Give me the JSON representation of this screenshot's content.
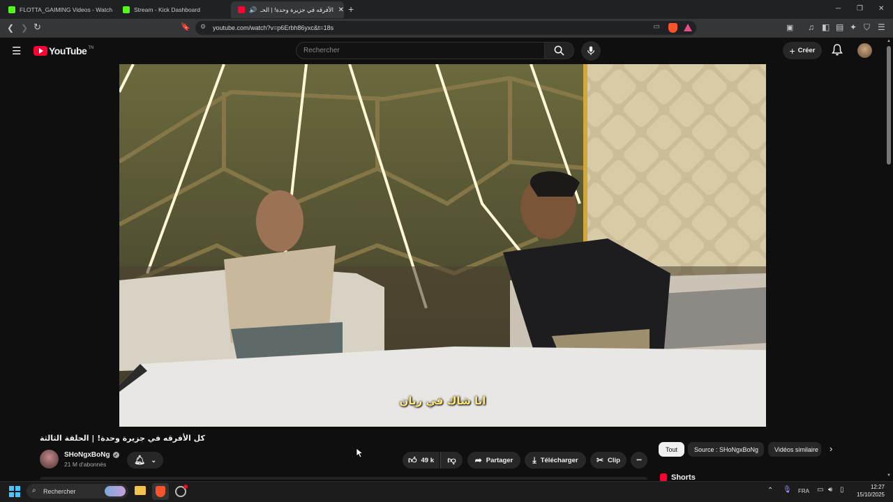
{
  "browser": {
    "tabs": [
      {
        "title": "FLOTTA_GAIMING Videos - Watch Cr",
        "favicon_color": "#53fc18"
      },
      {
        "title": "Stream - Kick Dashboard",
        "favicon_color": "#53fc18"
      },
      {
        "title": "كل الأفرقه في جزيرة وحدة! | الحـ",
        "favicon_color": "#ff0033"
      }
    ],
    "new_tab": "+",
    "url": "youtube.com/watch?v=p6Erbh86yxc&t=18s",
    "window_controls": {
      "minimize": "─",
      "maximize": "❐",
      "close": "✕"
    }
  },
  "youtube": {
    "logo_text": "YouTube",
    "logo_suffix": "TN",
    "search_placeholder": "Rechercher",
    "create_label": "Créer"
  },
  "video": {
    "subtitle": "انا شاك في ريان"
  },
  "details": {
    "title": "كل الأفرقه في جزيرة وحدة! | الحلقة الثالثة",
    "channel_name": "SHoNgxBoNg",
    "subscribers": "21 M d'abonnés",
    "likes": "49 k",
    "share": "Partager",
    "download": "Télécharger",
    "clip": "Clip",
    "more": "•••"
  },
  "sidebar": {
    "chips": [
      "Tout",
      "Source : SHoNgxBoNg",
      "Vidéos similaire"
    ],
    "shorts_label": "Shorts"
  },
  "taskbar": {
    "search_label": "Rechercher",
    "language": "FRA",
    "time": "12:27",
    "date": "15/10/2025"
  }
}
